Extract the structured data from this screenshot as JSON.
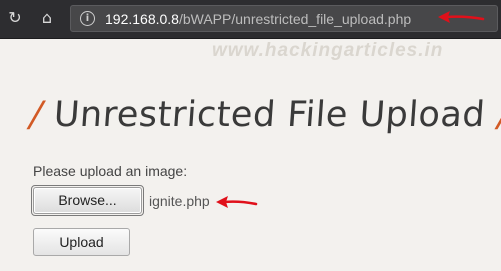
{
  "browser": {
    "reload_icon": "reload-icon",
    "home_icon": "home-icon",
    "info_icon": "info-icon",
    "url_host": "192.168.0.8",
    "url_path": "/bWAPP/unrestricted_file_upload.php"
  },
  "page": {
    "watermark": "www.hackingarticles.in",
    "slash": "/",
    "title": "Unrestricted File Upload",
    "upload_prompt": "Please upload an image:",
    "browse_label": "Browse...",
    "selected_file": "ignite.php",
    "upload_label": "Upload"
  },
  "colors": {
    "accent_slash": "#d25a25",
    "annotation_arrow": "#e0101a",
    "toolbar_bg": "#2d2d30",
    "page_bg": "#f3f1ee"
  },
  "annotations": [
    "red-arrow-url",
    "red-arrow-filename"
  ]
}
